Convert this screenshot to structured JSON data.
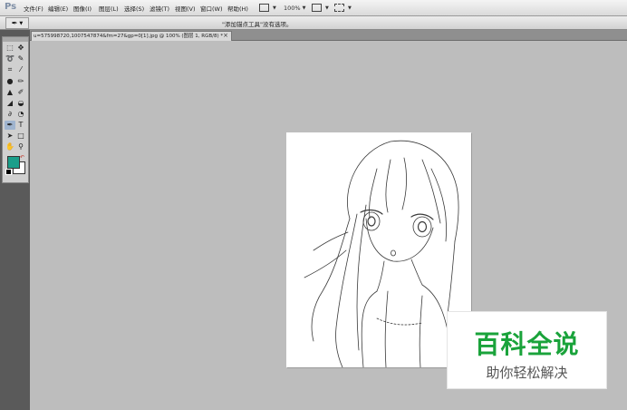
{
  "app_logo": "Ps",
  "menubar": {
    "items": [
      "文件(F)",
      "编辑(E)",
      "图像(I)",
      "图层(L)",
      "选择(S)",
      "滤镜(T)",
      "视图(V)",
      "窗口(W)",
      "帮助(H)"
    ],
    "zoom_value": "100%"
  },
  "options_bar": {
    "hint": "\"添加锚点工具\"没有选项。"
  },
  "document": {
    "tab_title": "u=575998720,1007547874&fm=27&gp=0[1].jpg @ 100% (图层 1, RGB/8) *",
    "close_glyph": "×"
  },
  "toolbox": {
    "foreground_color": "#1a9e8a",
    "background_color": "#ffffff"
  },
  "watermark": {
    "title": "百科全说",
    "subtitle": "助你轻松解决"
  }
}
